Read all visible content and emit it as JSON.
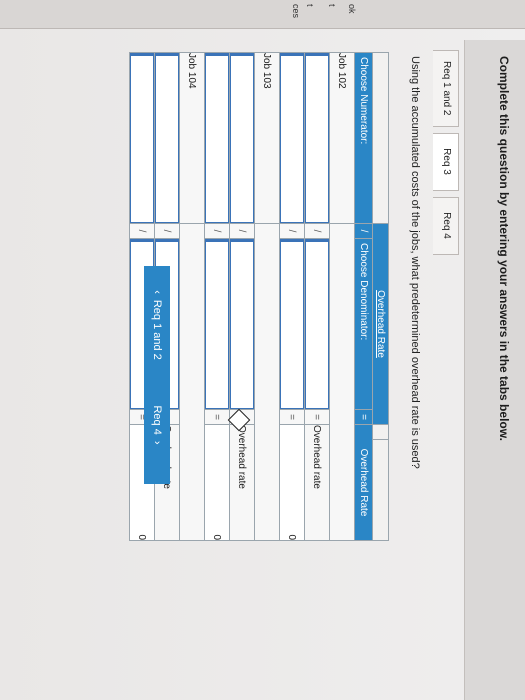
{
  "left_strip": [
    "ok",
    "t",
    "t",
    "ces"
  ],
  "instruction": "Complete this question by entering your answers in the tabs below.",
  "tabs": [
    {
      "label": "Req 1 and 2",
      "active": false
    },
    {
      "label": "Req 3",
      "active": true
    },
    {
      "label": "Req 4",
      "active": false
    }
  ],
  "question": "Using the accumulated costs of the jobs, what predetermined overhead rate is used?",
  "table": {
    "title": "Overhead Rate",
    "numerator_header": "Choose Numerator:",
    "divide_symbol": "/",
    "denominator_header": "Choose Denominator:",
    "equals_symbol": "=",
    "result_header": "Overhead Rate",
    "jobs": [
      {
        "label": "Job 102",
        "rate_label": "Overhead rate",
        "rate_value": "0"
      },
      {
        "label": "Job 103",
        "rate_label": "Overhead rate",
        "rate_value": "0"
      },
      {
        "label": "Job 104",
        "rate_label": "Overhead rate",
        "rate_value": "0"
      }
    ]
  },
  "nav": {
    "prev_label": "Req 1 and 2",
    "next_label": "Req 4"
  },
  "colors": {
    "accent": "#2a86c6",
    "input_border": "#3a73b8"
  }
}
